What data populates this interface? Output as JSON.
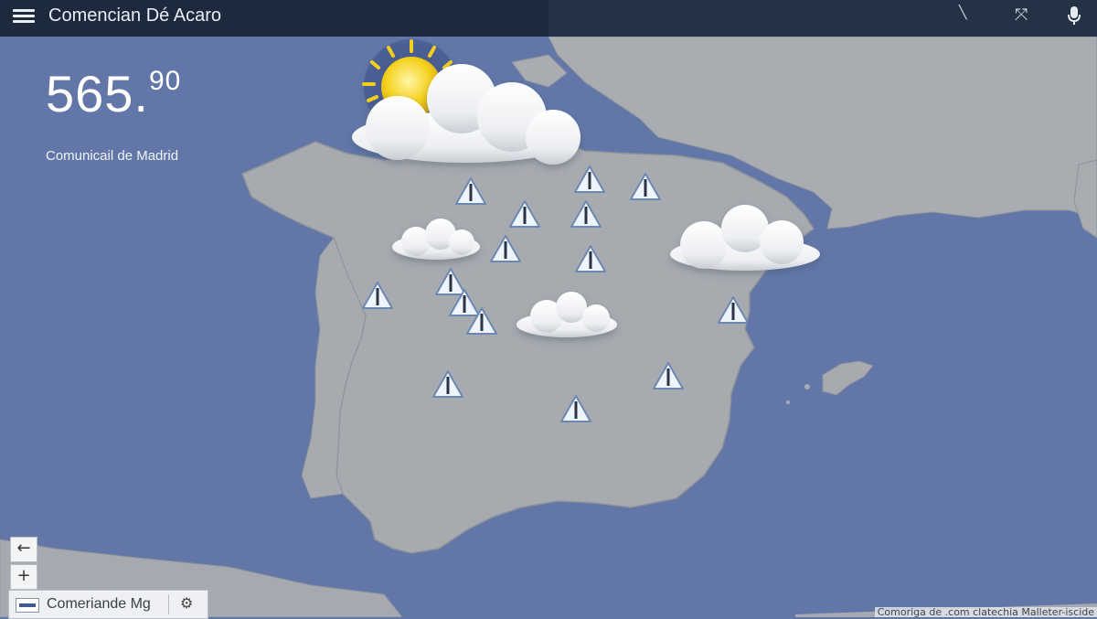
{
  "app": {
    "title": "Comencian Dé Acaro",
    "top_icons": [
      "cursor-icon",
      "tools-icon",
      "microphone-icon"
    ]
  },
  "weather": {
    "temperature_main": "565.",
    "temperature_sup": "90",
    "location": "Comunicail de Madrid",
    "condition_icon": "partly-cloudy-icon"
  },
  "map_controls": {
    "back_label": "←",
    "zoom_in_label": "+",
    "layer_label": "Comeriande Mg",
    "settings_icon": "gear-icon"
  },
  "attribution": "Comoriga de .com clatechia Malleter-iscide",
  "colors": {
    "sea": "#6277a8",
    "land": "#a7abb0",
    "topbar": "#1d2a3d",
    "warning_fill": "#eef4fb",
    "warning_stroke": "#6c88b0"
  }
}
